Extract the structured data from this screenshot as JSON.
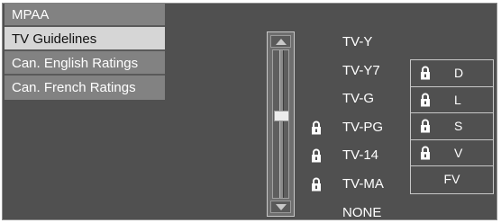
{
  "menu": {
    "items": [
      {
        "label": "MPAA",
        "selected": false
      },
      {
        "label": "TV Guidelines",
        "selected": true
      },
      {
        "label": "Can. English Ratings",
        "selected": false
      },
      {
        "label": "Can. French Ratings",
        "selected": false
      }
    ]
  },
  "slider": {
    "up_icon": "arrow-up-icon",
    "down_icon": "arrow-down-icon",
    "selected_level": "TV-PG"
  },
  "ratings": [
    {
      "label": "TV-Y",
      "locked": false
    },
    {
      "label": "TV-Y7",
      "locked": false
    },
    {
      "label": "TV-G",
      "locked": false
    },
    {
      "label": "TV-PG",
      "locked": true
    },
    {
      "label": "TV-14",
      "locked": true
    },
    {
      "label": "TV-MA",
      "locked": true
    },
    {
      "label": "NONE",
      "locked": false
    }
  ],
  "sub_ratings": [
    {
      "label": "D",
      "locked": true
    },
    {
      "label": "L",
      "locked": true
    },
    {
      "label": "S",
      "locked": true
    },
    {
      "label": "V",
      "locked": true
    },
    {
      "label": "FV",
      "locked": false
    }
  ],
  "colors": {
    "panel_bg": "#505050",
    "menu_item_bg": "#828282",
    "menu_selected_bg": "#d6d6d6",
    "text": "#ffffff"
  }
}
